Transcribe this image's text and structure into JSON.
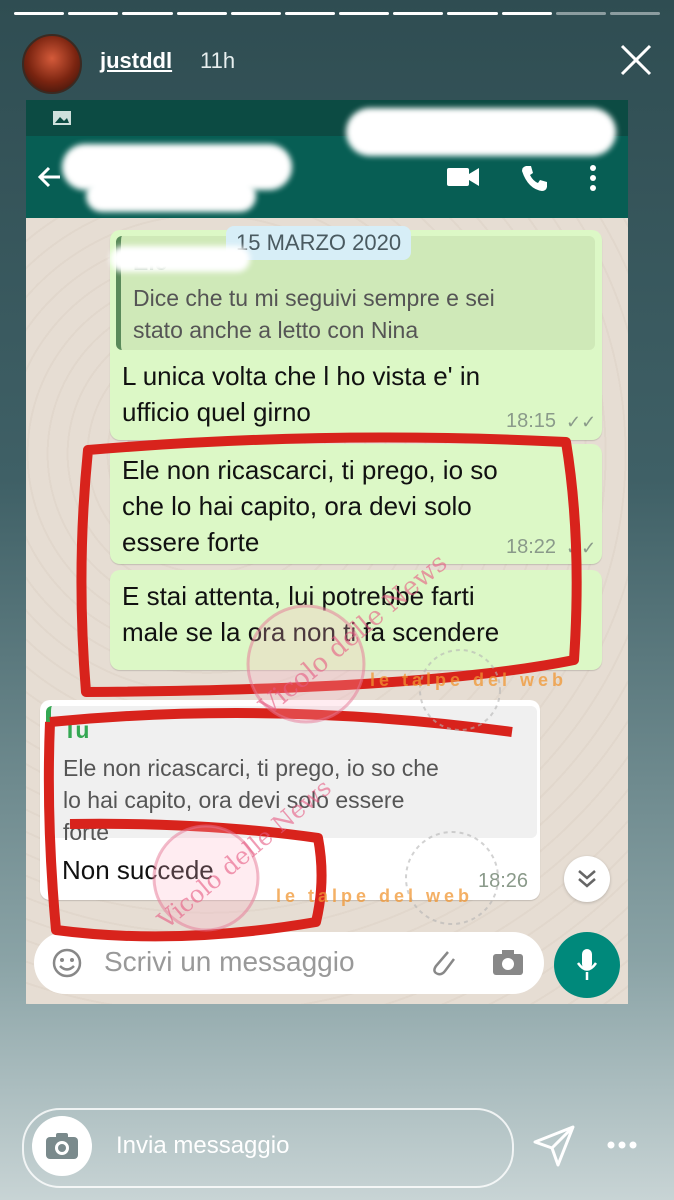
{
  "story": {
    "username": "justddl",
    "time": "11h",
    "progress_segments": 12,
    "progress_done": 10
  },
  "chat": {
    "date": "15 MARZO 2020",
    "quote1_sender": "Ele",
    "quote1_text_l1": "Dice che tu mi seguivi sempre e sei",
    "quote1_text_l2": "stato anche a letto con Nina",
    "msg1_l1": "L unica volta che l ho vista e' in",
    "msg1_l2": "ufficio quel girno",
    "msg1_time": "18:15",
    "msg2_l1": "Ele non ricascarci,  ti prego, io so",
    "msg2_l2": "che lo hai capito, ora devi solo",
    "msg2_l3": "essere forte",
    "msg2_time": "18:22",
    "msg3_l1": "E stai attenta, lui potrebbe farti",
    "msg3_l2": "male se la ora non ti fa scendere",
    "quote2_sender": "Tu",
    "quote2_l1": "Ele non ricascarci,  ti prego, io so che",
    "quote2_l2": "lo hai capito, ora devi solo essere",
    "quote2_l3": "forte",
    "reply_msg": "Non succede",
    "reply_time": "18:26",
    "input_placeholder": "Scrivi un messaggio"
  },
  "watermark": {
    "brand": "Vicolo delle News",
    "sticker": "le talpe del web"
  },
  "footer": {
    "reply_placeholder": "Invia messaggio"
  },
  "colors": {
    "accent_red": "#d8231c",
    "whatsapp_green": "#075e54",
    "bubble_out": "#dcf8c6"
  }
}
